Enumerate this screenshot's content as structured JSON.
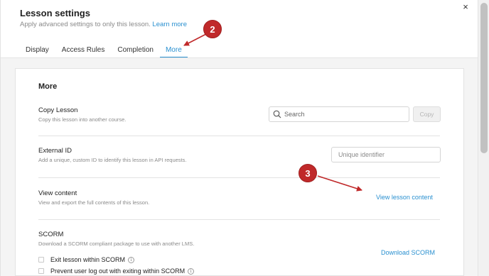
{
  "modal": {
    "title": "Lesson settings",
    "subtitle": "Apply advanced settings to only this lesson.",
    "learn_more": "Learn more",
    "close_glyph": "×"
  },
  "tabs": [
    {
      "label": "Display"
    },
    {
      "label": "Access Rules"
    },
    {
      "label": "Completion"
    },
    {
      "label": "More"
    }
  ],
  "active_tab": "More",
  "panel": {
    "title": "More",
    "copy_lesson": {
      "title": "Copy Lesson",
      "desc": "Copy this lesson into another course.",
      "search_placeholder": "Search",
      "copy_button": "Copy"
    },
    "external_id": {
      "title": "External ID",
      "desc": "Add a unique, custom ID to identify this lesson in API requests.",
      "placeholder": "Unique identifier"
    },
    "view_content": {
      "title": "View content",
      "desc": "View and export the full contents of this lesson.",
      "link": "View lesson content"
    },
    "scorm": {
      "title": "SCORM",
      "desc": "Download a SCORM compliant package to use with another LMS.",
      "link": "Download SCORM",
      "options": [
        {
          "label": "Exit lesson within SCORM"
        },
        {
          "label": "Prevent user log out with exiting within SCORM"
        }
      ]
    }
  },
  "annotations": {
    "badge_2": "2",
    "badge_3": "3",
    "color": "#c0292a"
  },
  "colors": {
    "accent": "#2a90d0",
    "muted_text": "#8a8a8a",
    "panel_bg": "#f4f4f4"
  }
}
